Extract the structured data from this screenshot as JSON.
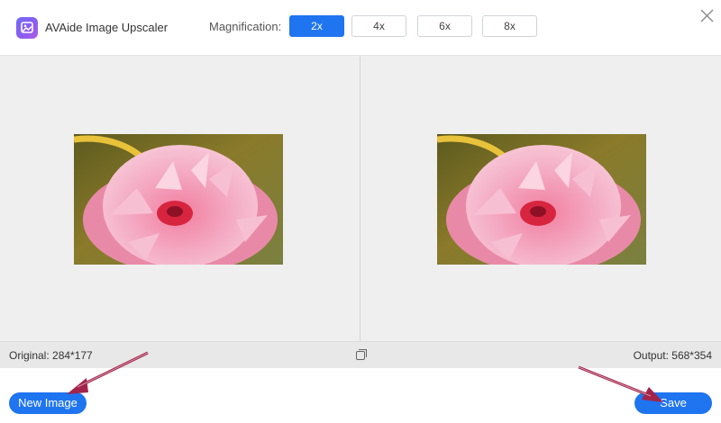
{
  "app": {
    "title": "AVAide Image Upscaler",
    "logo_icon": "image-upscaler-logo-icon",
    "close_icon": "close-icon"
  },
  "magnification": {
    "label": "Magnification:",
    "options": [
      "2x",
      "4x",
      "6x",
      "8x"
    ],
    "selected": "2x"
  },
  "preview": {
    "original_image": "pink-dahlia-flower-photo",
    "output_image": "pink-dahlia-flower-photo"
  },
  "info": {
    "original": "Original: 284*177",
    "output": "Output: 568*354",
    "compare_icon": "compare-icon"
  },
  "footer": {
    "new_image_label": "New Image",
    "save_label": "Save"
  },
  "annotations": {
    "arrow_icon": "pointer-arrow-icon",
    "arrow_color": "#a3244a"
  },
  "colors": {
    "accent": "#1f74f0",
    "preview_bg": "#efefef",
    "info_bg": "#e8e8e8"
  }
}
